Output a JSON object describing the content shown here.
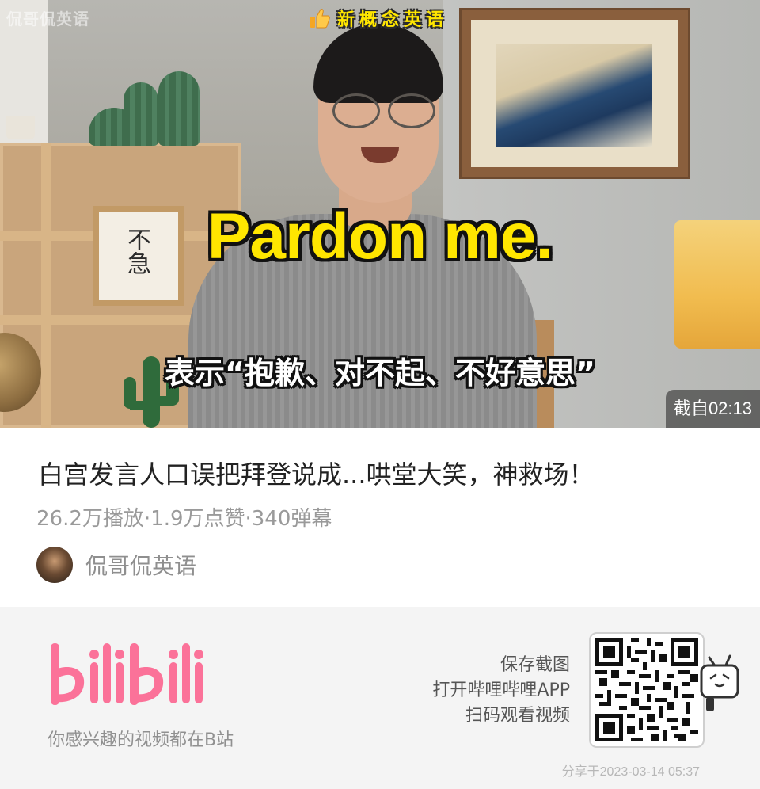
{
  "video": {
    "watermark": "侃哥侃英语",
    "top_badge": "新概念英语",
    "caption_en": "Pardon me.",
    "caption_zh": "表示“抱歉、对不起、不好意思”",
    "calligraphy": "不急",
    "timestamp": "截自02:13"
  },
  "info": {
    "title": "白宫发言人口误把拜登说成...哄堂大笑，神救场！",
    "stats": "26.2万播放·1.9万点赞·340弹幕",
    "uploader": "侃哥侃英语"
  },
  "footer": {
    "logo": "bilibili",
    "slogan": "你感兴趣的视频都在B站",
    "promo_lines": [
      "保存截图",
      "打开哔哩哔哩APP",
      "扫码观看视频"
    ],
    "share_time": "分享于2023-03-14 05:37"
  },
  "colors": {
    "bilibili_pink": "#fb7299",
    "caption_yellow": "#ffe600"
  }
}
